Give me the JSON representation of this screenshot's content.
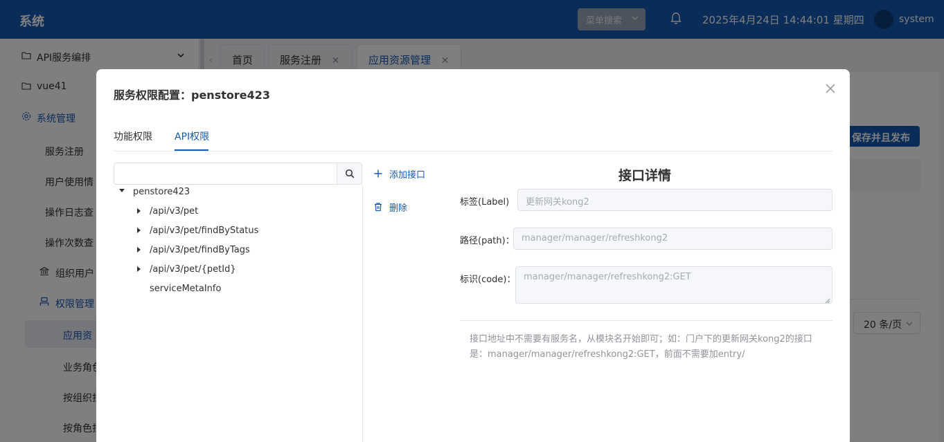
{
  "header": {
    "brand": "系统",
    "menu_search": "菜单搜索",
    "datetime": "2025年4月24日 14:44:01 星期四",
    "username": "system"
  },
  "sidebar": {
    "items": [
      {
        "label": "API服务编排",
        "icon": "folder-icon"
      },
      {
        "label": "vue41",
        "icon": "folder-icon"
      },
      {
        "label": "系统管理",
        "icon": "gear-icon"
      },
      {
        "label": "服务注册"
      },
      {
        "label": "用户使用情"
      },
      {
        "label": "操作日志查"
      },
      {
        "label": "操作次数查"
      },
      {
        "label": "组织用户",
        "icon": "bank-icon"
      },
      {
        "label": "权限管理",
        "icon": "user-icon"
      },
      {
        "label": "应用资"
      },
      {
        "label": "业务角色"
      },
      {
        "label": "按组织担"
      },
      {
        "label": "按角色担"
      }
    ]
  },
  "tabs": [
    {
      "label": "首页"
    },
    {
      "label": "服务注册",
      "close": "✕"
    },
    {
      "label": "应用资源管理",
      "close": "✕"
    }
  ],
  "page": {
    "publish_button": "保存并且发布",
    "page_size": "20 条/页"
  },
  "dialog": {
    "title": "服务权限配置：penstore423",
    "tabs": [
      "功能权限",
      "API权限"
    ],
    "search": {
      "value": "",
      "placeholder": ""
    },
    "tree": {
      "root": "penstore423",
      "children": [
        "/api/v3/pet",
        "/api/v3/pet/findByStatus",
        "/api/v3/pet/findByTags",
        "/api/v3/pet/{petId}",
        "serviceMetaInfo"
      ]
    },
    "actions": {
      "add": "添加接口",
      "delete": "删除"
    },
    "detail": {
      "title": "接口详情",
      "label_field": {
        "label": "标签(Label)",
        "value": "更新网关kong2"
      },
      "path_field": {
        "label": "路径(path)：",
        "value": "manager/manager/refreshkong2"
      },
      "code_field": {
        "label": "标识(code)：",
        "value": "manager/manager/refreshkong2:GET"
      },
      "hint": "接口地址中不需要有服务名，从模块名开始即可；如：门户下的更新网关kong2的接口是：manager/manager/refreshkong2:GET，前面不需要加entry/"
    }
  },
  "colors": {
    "primary": "#1559b3",
    "header_bg": "#1559b3"
  }
}
